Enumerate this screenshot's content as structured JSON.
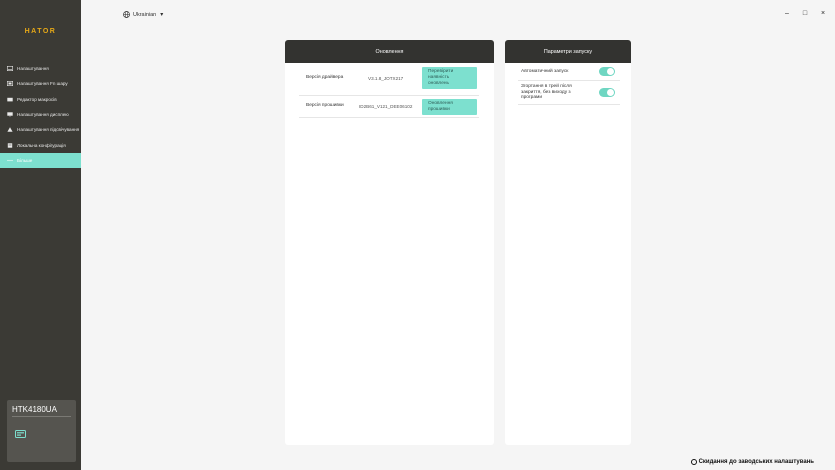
{
  "brand": {
    "logo_text": "HATOR"
  },
  "sidebar": {
    "items": [
      {
        "label": "Налаштування",
        "icon": "keyboard-icon",
        "active": false
      },
      {
        "label": "Налаштування Fn шару",
        "icon": "fn-layer-icon",
        "active": false
      },
      {
        "label": "Редактор макросів",
        "icon": "macro-icon",
        "active": false
      },
      {
        "label": "Налаштування дисплею",
        "icon": "display-icon",
        "active": false
      },
      {
        "label": "Налаштування підсвічування",
        "icon": "lighting-icon",
        "active": false
      },
      {
        "label": "Локальна конфігурація",
        "icon": "config-icon",
        "active": false
      },
      {
        "label": "Більше",
        "icon": "more-icon",
        "active": true
      }
    ],
    "device": {
      "name": "HTK4180UA",
      "icon": "keyboard-device-icon"
    }
  },
  "topbar": {
    "language": "Ukrainian",
    "globe_icon": "globe-icon"
  },
  "window_controls": {
    "minimize": "–",
    "maximize": "□",
    "close": "×"
  },
  "updates_panel": {
    "title": "Оновлення",
    "rows": [
      {
        "label": "Версія драйвера",
        "value": "V3.1.8_JOTX217",
        "button": "Перевірити наявність оновлень"
      },
      {
        "label": "Версія прошивки",
        "value": "ID2B61_V121_DEE06102",
        "button": "Оновлення прошивки"
      }
    ]
  },
  "startup_panel": {
    "title": "Параметри запуску",
    "options": [
      {
        "label": "Автоматичний запуск",
        "enabled": true
      },
      {
        "label": "Згортання в трей після закриття, без виходу з програми",
        "enabled": true
      }
    ]
  },
  "footer": {
    "reset_label": "Скидання до заводських налаштувань"
  },
  "colors": {
    "accent": "#7de0cf",
    "sidebar_bg": "#3b3a35",
    "logo": "#e6a817",
    "toggle": "#6fd6c2"
  }
}
